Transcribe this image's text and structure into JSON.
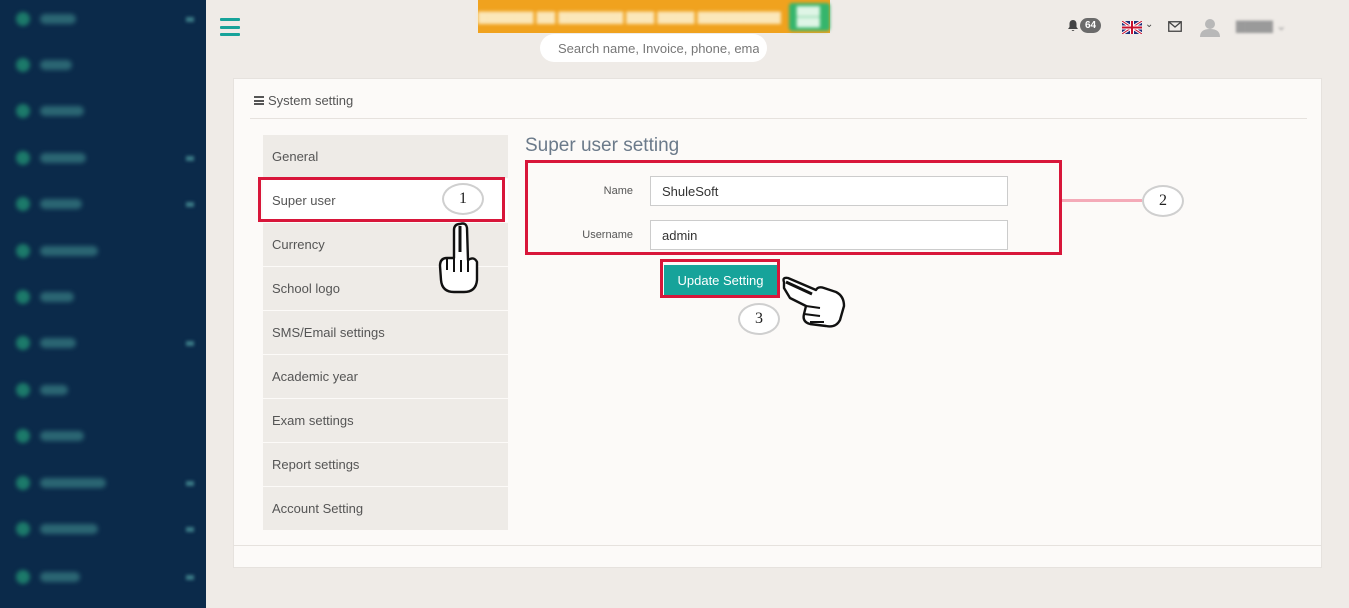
{
  "sidebar": {
    "items": [
      {
        "caret": true
      },
      {
        "caret": false
      },
      {
        "caret": false
      },
      {
        "caret": true
      },
      {
        "caret": true
      },
      {
        "caret": false
      },
      {
        "caret": false
      },
      {
        "caret": true
      },
      {
        "caret": false
      },
      {
        "caret": false
      },
      {
        "caret": true
      },
      {
        "caret": true
      },
      {
        "caret": true
      }
    ]
  },
  "topbar": {
    "search_placeholder": "Search name, Invoice, phone, ema",
    "notification_count": "64",
    "accent_color": "#16a39a"
  },
  "panel": {
    "title": "System setting"
  },
  "settings_nav": {
    "items": [
      {
        "label": "General"
      },
      {
        "label": "Super user"
      },
      {
        "label": "Currency"
      },
      {
        "label": "School logo"
      },
      {
        "label": "SMS/Email settings"
      },
      {
        "label": "Academic year"
      },
      {
        "label": "Exam settings"
      },
      {
        "label": "Report settings"
      },
      {
        "label": "Account Setting"
      }
    ],
    "active": "Super user"
  },
  "super_user_form": {
    "title": "Super user setting",
    "name_label": "Name",
    "name_value": "ShuleSoft",
    "username_label": "Username",
    "username_value": "admin",
    "submit_label": "Update Setting"
  },
  "annotations": {
    "step1": "1",
    "step2": "2",
    "step3": "3",
    "highlight_color": "#d8163a"
  }
}
